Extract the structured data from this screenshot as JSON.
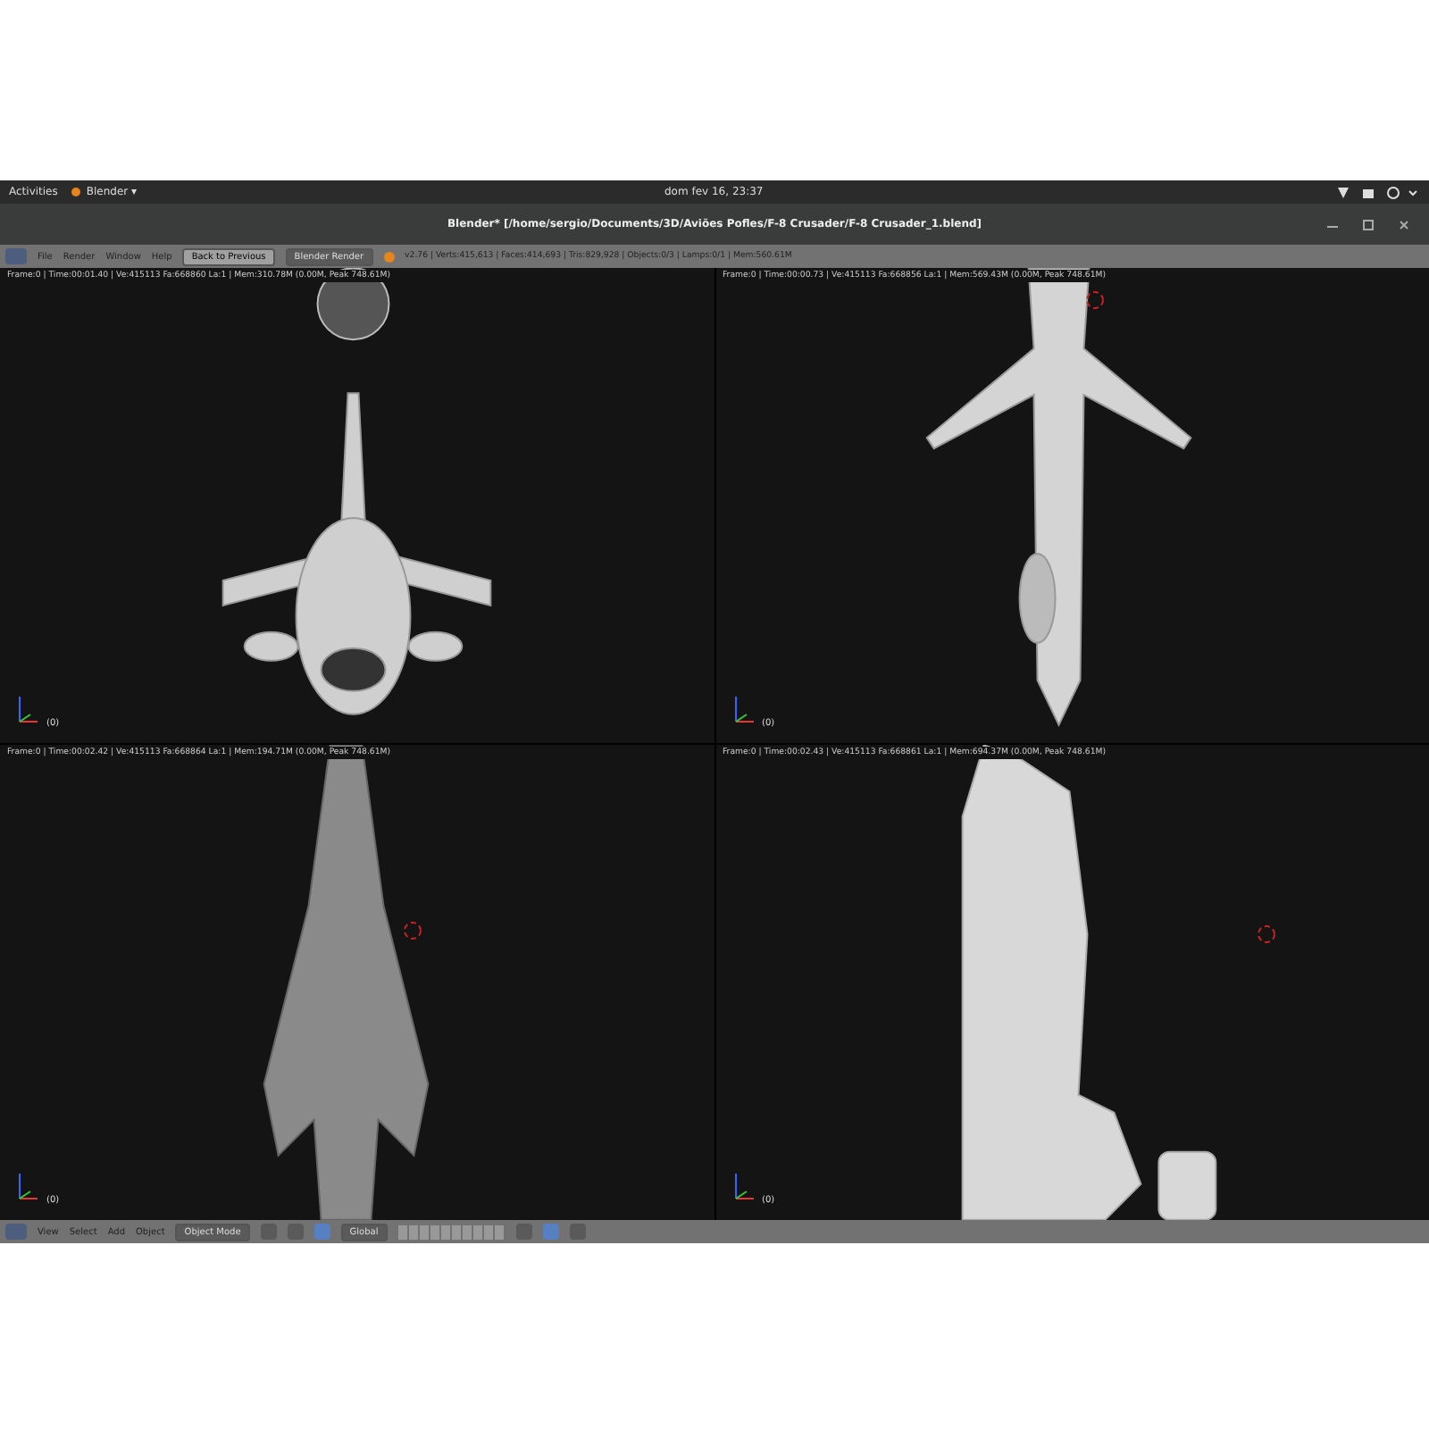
{
  "top_bar": {
    "activities": "Activities",
    "app_menu": "Blender ▾",
    "clock": "dom fev 16, 23:37"
  },
  "window": {
    "title": "Blender* [/home/sergio/Documents/3D/Aviões Pofles/F-8 Crusader/F-8 Crusader_1.blend]"
  },
  "info_header": {
    "menus": [
      "File",
      "Render",
      "Window",
      "Help"
    ],
    "back_button": "Back to Previous",
    "render_engine": "Blender Render",
    "stats": "v2.76 | Verts:415,613 | Faces:414,693 | Tris:829,928 | Objects:0/3 | Lamps:0/1 | Mem:560.61M"
  },
  "viewports": [
    {
      "kind": "front",
      "header": "Frame:0 | Time:00:01.40 | Ve:415113 Fa:668860 La:1 | Mem:310.78M (0.00M, Peak 748.61M)",
      "frame_label": "(0)",
      "cursor": false
    },
    {
      "kind": "top",
      "header": "Frame:0 | Time:00:00.73 | Ve:415113 Fa:668856 La:1 | Mem:569.43M (0.00M, Peak 748.61M)",
      "frame_label": "(0)",
      "cursor": true
    },
    {
      "kind": "bottom",
      "header": "Frame:0 | Time:00:02.42 | Ve:415113 Fa:668864 La:1 | Mem:194.71M (0.00M, Peak 748.61M)",
      "frame_label": "(0)",
      "cursor": true
    },
    {
      "kind": "side",
      "header": "Frame:0 | Time:00:02.43 | Ve:415113 Fa:668861 La:1 | Mem:694.37M (0.00M, Peak 748.61M)",
      "frame_label": "(0)",
      "cursor": true
    }
  ],
  "bottom_toolbar": {
    "menus": [
      "View",
      "Select",
      "Add",
      "Object"
    ],
    "mode": "Object Mode",
    "orientation": "Global"
  }
}
